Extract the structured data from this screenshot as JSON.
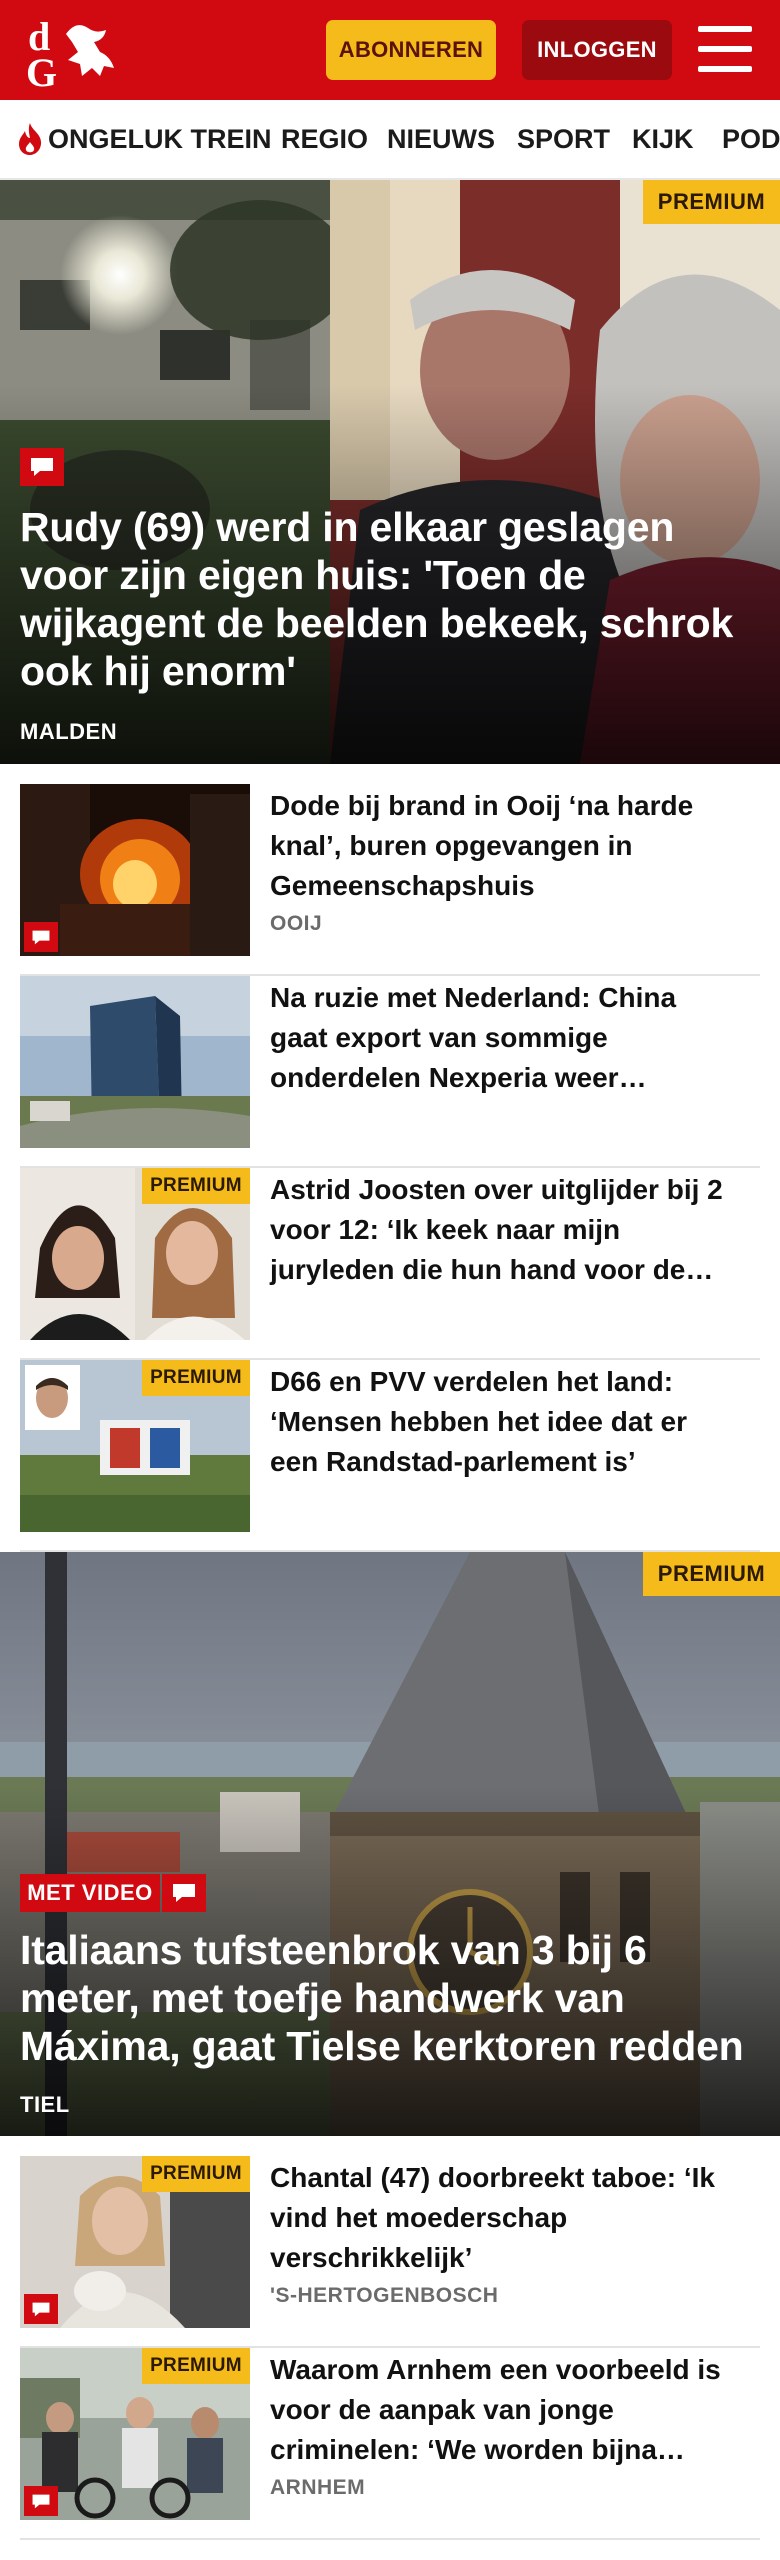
{
  "header": {
    "logo_alt": "dG",
    "subscribe_label": "ABONNEREN",
    "login_label": "INLOGGEN",
    "brand_red": "#d10a11",
    "accent_yellow": "#f4bb1b"
  },
  "nav": {
    "items": [
      {
        "label": "ONGELUK TREIN",
        "icon": "flame-icon"
      },
      {
        "label": "REGIO"
      },
      {
        "label": "NIEUWS"
      },
      {
        "label": "SPORT"
      },
      {
        "label": "KIJK"
      },
      {
        "label": "POD"
      }
    ]
  },
  "hero1": {
    "badge": "PREMIUM",
    "title": "Rudy (69) werd in elkaar geslagen voor zijn eigen huis: 'Toen de wijkagent de beelden bekeek, schrok ook hij enorm'",
    "location": "MALDEN"
  },
  "articles": [
    {
      "title": "Dode bij brand in Ooij ‘na harde knal’, buren opgevangen in Gemeenschapshuis",
      "location": "OOIJ",
      "premium": "",
      "comments": true
    },
    {
      "title": "Na ruzie met Nederland: China gaat export van sommige onderdelen Nexperia weer…",
      "location": "",
      "premium": "",
      "comments": false
    },
    {
      "title": "Astrid Joosten over uitglijder bij 2 voor 12: ‘Ik keek naar mijn juryleden die hun hand voor de…",
      "location": "",
      "premium": "PREMIUM",
      "comments": false
    },
    {
      "title": "D66 en PVV verdelen het land: ‘Mensen hebben het idee dat er een Randstad-parlement is’",
      "location": "",
      "premium": "PREMIUM",
      "comments": false
    }
  ],
  "hero2": {
    "badge": "PREMIUM",
    "video_badge": "MET VIDEO",
    "title": "Italiaans tufsteenbrok van 3 bij 6 meter, met toefje handwerk van Máxima, gaat Tielse kerktoren redden",
    "location": "TIEL"
  },
  "articles2": [
    {
      "title": "Chantal (47) doorbreekt taboe: ‘Ik vind het moederschap verschrikkelijk’",
      "location": "'S-HERTOGENBOSCH",
      "premium": "PREMIUM",
      "comments": true
    },
    {
      "title": "Waarom Arnhem een voorbeeld is voor de aanpak van jonge criminelen: ‘We worden bijna…",
      "location": "ARNHEM",
      "premium": "PREMIUM",
      "comments": true
    }
  ]
}
